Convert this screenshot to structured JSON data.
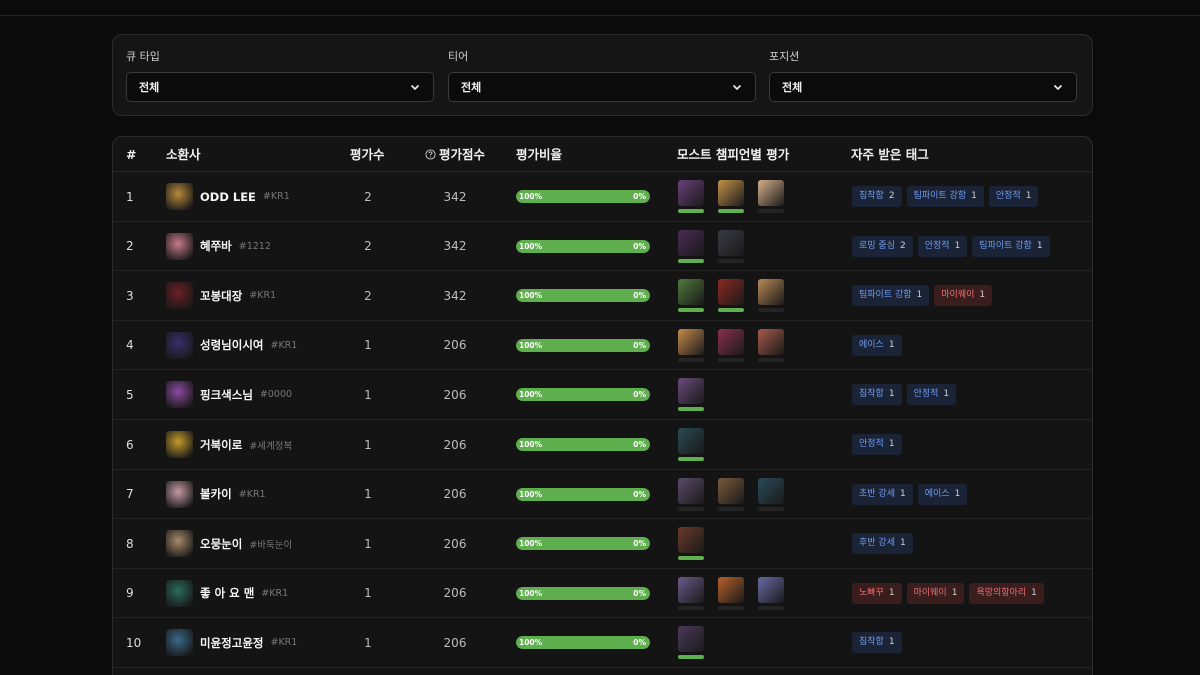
{
  "filters": [
    {
      "label": "큐 타입",
      "value": "전체"
    },
    {
      "label": "티어",
      "value": "전체"
    },
    {
      "label": "포지션",
      "value": "전체"
    }
  ],
  "table": {
    "headers": {
      "rank": "#",
      "summoner": "소환사",
      "count": "평가수",
      "score": "평가점수",
      "ratio": "평가비율",
      "champs": "모스트 챔피언별 평가",
      "tags": "자주 받은 태그"
    },
    "rows": [
      {
        "rank": "1",
        "name": "ODD LEE",
        "tag": "#KR1",
        "count": "2",
        "score": "342",
        "ratio_left": "100%",
        "ratio_right": "0%",
        "ratio": 1.0,
        "avatar_color": "#b88a3c",
        "champs": [
          {
            "icon": "champion-portrait",
            "color": "#6a3f7a",
            "rated": true
          },
          {
            "icon": "champion-portrait",
            "color": "#c4924a",
            "rated": true
          },
          {
            "icon": "champion-portrait",
            "color": "#d6b08a",
            "rated": false
          }
        ],
        "tags": [
          {
            "label": "침착함",
            "count": "2",
            "color": "blue"
          },
          {
            "label": "팀파이트 강함",
            "count": "1",
            "color": "blue"
          },
          {
            "label": "안정적",
            "count": "1",
            "color": "blue"
          }
        ]
      },
      {
        "rank": "2",
        "name": "혜쭈바",
        "tag": "#1212",
        "count": "2",
        "score": "342",
        "ratio_left": "100%",
        "ratio_right": "0%",
        "ratio": 1.0,
        "avatar_color": "#c77a8a",
        "champs": [
          {
            "icon": "champion-portrait",
            "color": "#4b2a55",
            "rated": true
          },
          {
            "icon": "champion-portrait",
            "color": "#3a3a44",
            "rated": false
          }
        ],
        "tags": [
          {
            "label": "로밍 중심",
            "count": "2",
            "color": "blue"
          },
          {
            "label": "안정적",
            "count": "1",
            "color": "blue"
          },
          {
            "label": "팀파이트 강함",
            "count": "1",
            "color": "blue"
          }
        ]
      },
      {
        "rank": "3",
        "name": "꼬봉대장",
        "tag": "#KR1",
        "count": "2",
        "score": "342",
        "ratio_left": "100%",
        "ratio_right": "0%",
        "ratio": 1.0,
        "avatar_color": "#6b1f24",
        "champs": [
          {
            "icon": "champion-portrait",
            "color": "#4f7a3a",
            "rated": true
          },
          {
            "icon": "champion-portrait",
            "color": "#8c2a22",
            "rated": true
          },
          {
            "icon": "champion-portrait",
            "color": "#b88a55",
            "rated": false
          }
        ],
        "tags": [
          {
            "label": "팀파이트 강함",
            "count": "1",
            "color": "blue"
          },
          {
            "label": "마이웨이",
            "count": "1",
            "color": "red"
          }
        ]
      },
      {
        "rank": "4",
        "name": "성령님이시여",
        "tag": "#KR1",
        "count": "1",
        "score": "206",
        "ratio_left": "100%",
        "ratio_right": "0%",
        "ratio": 1.0,
        "avatar_color": "#3a2f6a",
        "champs": [
          {
            "icon": "champion-portrait",
            "color": "#c48a4a",
            "rated": false
          },
          {
            "icon": "champion-portrait",
            "color": "#8a3050",
            "rated": false
          },
          {
            "icon": "champion-portrait",
            "color": "#a65a4a",
            "rated": false
          }
        ],
        "tags": [
          {
            "label": "에이스",
            "count": "1",
            "color": "blue"
          }
        ]
      },
      {
        "rank": "5",
        "name": "핑크색스님",
        "tag": "#0000",
        "count": "1",
        "score": "206",
        "ratio_left": "100%",
        "ratio_right": "0%",
        "ratio": 1.0,
        "avatar_color": "#8a4aa0",
        "champs": [
          {
            "icon": "champion-portrait",
            "color": "#6a4a7a",
            "rated": true
          }
        ],
        "tags": [
          {
            "label": "침착함",
            "count": "1",
            "color": "blue"
          },
          {
            "label": "안정적",
            "count": "1",
            "color": "blue"
          }
        ]
      },
      {
        "rank": "6",
        "name": "거북이로",
        "tag": "#세계정복",
        "count": "1",
        "score": "206",
        "ratio_left": "100%",
        "ratio_right": "0%",
        "ratio": 1.0,
        "avatar_color": "#c49a2a",
        "champs": [
          {
            "icon": "champion-portrait",
            "color": "#2a4a55",
            "rated": true
          }
        ],
        "tags": [
          {
            "label": "안정적",
            "count": "1",
            "color": "blue"
          }
        ]
      },
      {
        "rank": "7",
        "name": "볼카이",
        "tag": "#KR1",
        "count": "1",
        "score": "206",
        "ratio_left": "100%",
        "ratio_right": "0%",
        "ratio": 1.0,
        "avatar_color": "#c49aa6",
        "champs": [
          {
            "icon": "champion-portrait",
            "color": "#5a4a6a",
            "rated": false
          },
          {
            "icon": "champion-portrait",
            "color": "#7a5a3a",
            "rated": false
          },
          {
            "icon": "champion-portrait",
            "color": "#2a4a5a",
            "rated": false
          }
        ],
        "tags": [
          {
            "label": "초반 강세",
            "count": "1",
            "color": "blue"
          },
          {
            "label": "에이스",
            "count": "1",
            "color": "blue"
          }
        ]
      },
      {
        "rank": "8",
        "name": "오뭉눈이",
        "tag": "#바둑눈이",
        "count": "1",
        "score": "206",
        "ratio_left": "100%",
        "ratio_right": "0%",
        "ratio": 1.0,
        "avatar_color": "#a68a6a",
        "champs": [
          {
            "icon": "champion-portrait",
            "color": "#6a3a2a",
            "rated": true
          }
        ],
        "tags": [
          {
            "label": "후반 강세",
            "count": "1",
            "color": "blue"
          }
        ]
      },
      {
        "rank": "9",
        "name": "좋 아 요 맨",
        "tag": "#KR1",
        "count": "1",
        "score": "206",
        "ratio_left": "100%",
        "ratio_right": "0%",
        "ratio": 1.0,
        "avatar_color": "#2a6a5a",
        "champs": [
          {
            "icon": "champion-portrait",
            "color": "#6a5a8a",
            "rated": false
          },
          {
            "icon": "champion-portrait",
            "color": "#b8602a",
            "rated": false
          },
          {
            "icon": "champion-portrait",
            "color": "#6a6aa6",
            "rated": false
          }
        ],
        "tags": [
          {
            "label": "노빠꾸",
            "count": "1",
            "color": "red"
          },
          {
            "label": "마이웨이",
            "count": "1",
            "color": "red"
          },
          {
            "label": "욕망의항아리",
            "count": "1",
            "color": "red"
          }
        ]
      },
      {
        "rank": "10",
        "name": "미윤정고윤정",
        "tag": "#KR1",
        "count": "1",
        "score": "206",
        "ratio_left": "100%",
        "ratio_right": "0%",
        "ratio": 1.0,
        "avatar_color": "#3a6a8a",
        "champs": [
          {
            "icon": "champion-portrait",
            "color": "#4a3a5a",
            "rated": true
          }
        ],
        "tags": [
          {
            "label": "침착함",
            "count": "1",
            "color": "blue"
          }
        ]
      }
    ]
  }
}
